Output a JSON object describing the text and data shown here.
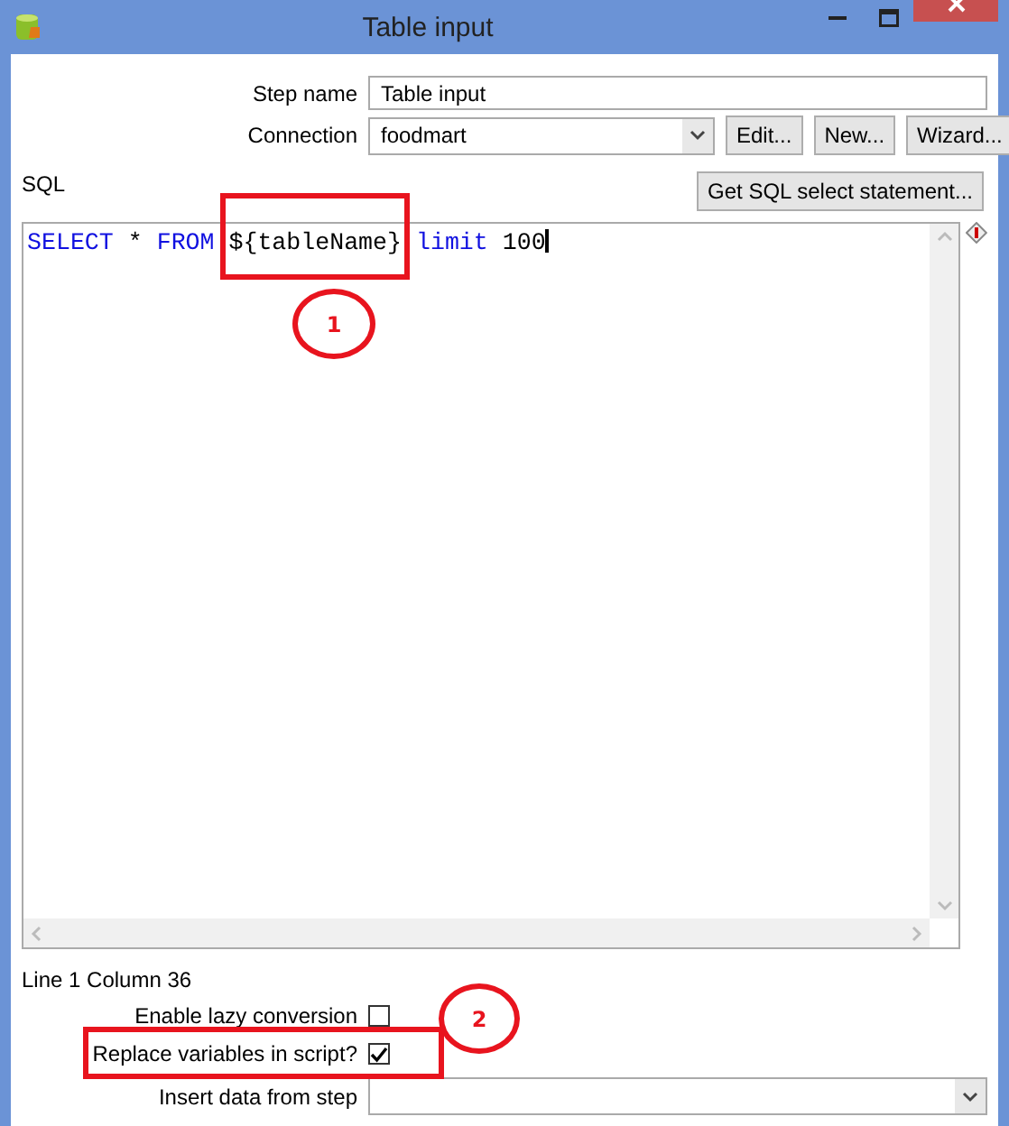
{
  "window": {
    "title": "Table input"
  },
  "step_name": {
    "label": "Step name",
    "value": "Table input"
  },
  "connection": {
    "label": "Connection",
    "value": "foodmart",
    "buttons": [
      {
        "label": "Edit..."
      },
      {
        "label": "New..."
      },
      {
        "label": "Wizard..."
      }
    ]
  },
  "sql": {
    "label": "SQL",
    "button": "Get SQL select statement...",
    "tokens": [
      {
        "text": "SELECT",
        "kind": "keyword"
      },
      {
        "text": " * ",
        "kind": "plain"
      },
      {
        "text": "FROM",
        "kind": "keyword"
      },
      {
        "text": " ${tableName} ",
        "kind": "plain"
      },
      {
        "text": "limit",
        "kind": "keyword"
      },
      {
        "text": " 100",
        "kind": "plain"
      }
    ]
  },
  "position": "Line 1 Column 36",
  "options": [
    {
      "label": "Enable lazy conversion",
      "checked": false
    },
    {
      "label": "Replace variables in script?",
      "checked": true
    }
  ],
  "insert_from_step": {
    "label": "Insert data from step"
  },
  "annotations": [
    {
      "number": "1"
    },
    {
      "number": "2"
    }
  ]
}
